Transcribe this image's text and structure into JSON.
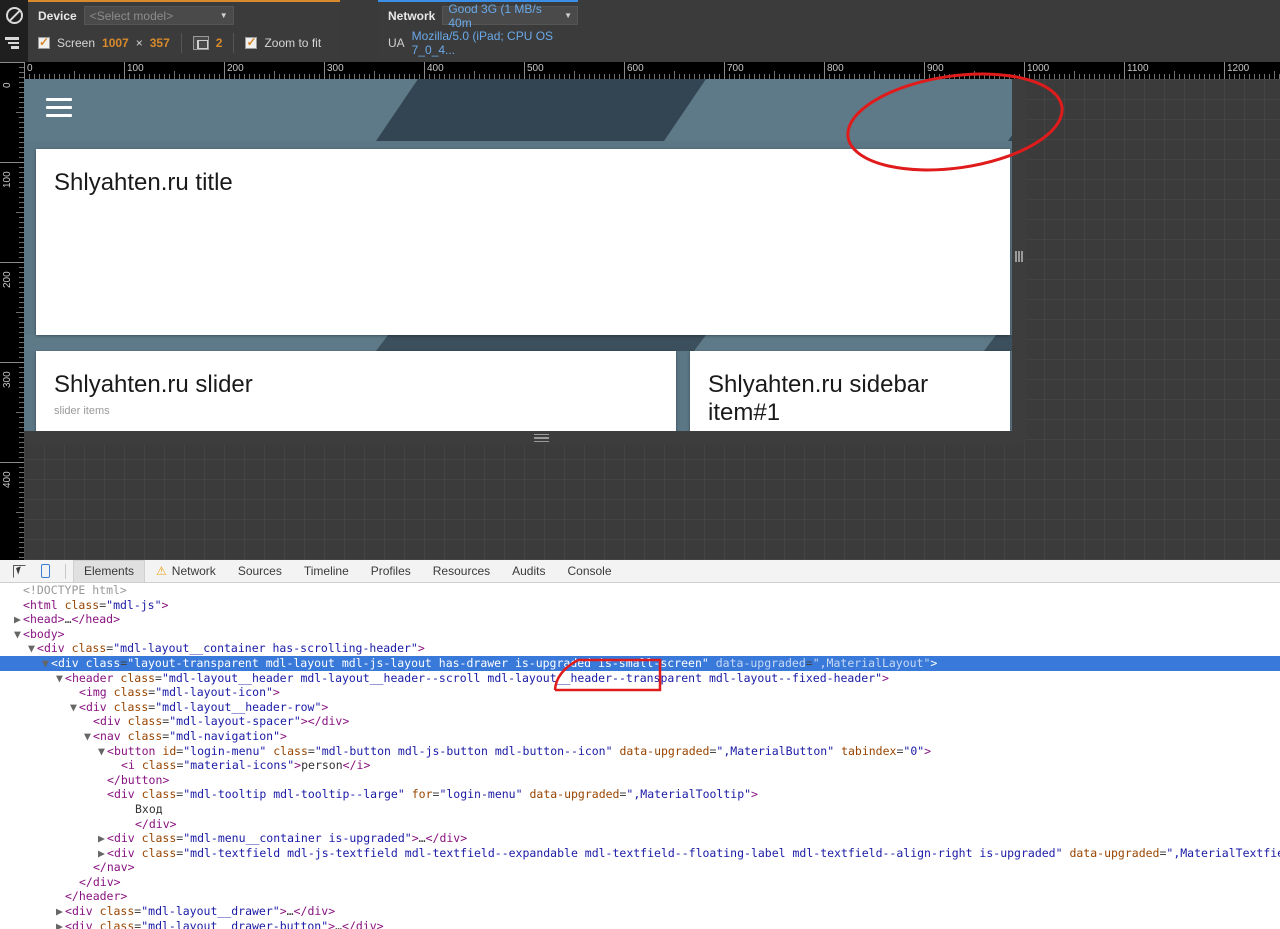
{
  "device_toolbar": {
    "icons": {
      "block": "block-icon",
      "throttle": "network-throttle-icon"
    },
    "device": {
      "label": "Device",
      "model_value": "<Select model>",
      "screen_label": "Screen",
      "width": "1007",
      "times": "×",
      "height": "357",
      "dpr_value": "2",
      "zoom_label": "Zoom to fit"
    },
    "network": {
      "label": "Network",
      "value": "Good 3G (1 MB/s 40m",
      "ua_label": "UA",
      "ua_value": "Mozilla/5.0 (iPad; CPU OS 7_0_4..."
    }
  },
  "rulers": {
    "horizontal": [
      "0",
      "100",
      "200",
      "300",
      "400",
      "500",
      "600",
      "700",
      "800",
      "900",
      "1000",
      "1100",
      "1200"
    ],
    "vertical": [
      "0",
      "100",
      "200",
      "300",
      "400"
    ]
  },
  "page": {
    "hamburger": "menu-icon",
    "title_card": "Shlyahten.ru title",
    "slider_card": "Shlyahten.ru slider",
    "slider_card_sub": "slider items",
    "sidebar_card": "Shlyahten.ru sidebar item#1"
  },
  "devtools": {
    "buttons": {
      "inspect": "inspect-element-icon",
      "device": "device-toolbar-icon"
    },
    "tabs": [
      {
        "label": "Elements",
        "active": true,
        "warn": false
      },
      {
        "label": "Network",
        "active": false,
        "warn": true
      },
      {
        "label": "Sources",
        "active": false,
        "warn": false
      },
      {
        "label": "Timeline",
        "active": false,
        "warn": false
      },
      {
        "label": "Profiles",
        "active": false,
        "warn": false
      },
      {
        "label": "Resources",
        "active": false,
        "warn": false
      },
      {
        "label": "Audits",
        "active": false,
        "warn": false
      },
      {
        "label": "Console",
        "active": false,
        "warn": false
      }
    ],
    "dom": [
      {
        "indent": 0,
        "arrow": "",
        "html": "<span class=\"cmt\">&lt;!DOCTYPE html&gt;</span>"
      },
      {
        "indent": 0,
        "arrow": "",
        "html": "<span class=\"punc\">&lt;</span><span class=\"tag\">html</span> <span class=\"attr\">class</span>=<span class=\"val\">\"mdl-js\"</span><span class=\"punc\">&gt;</span>"
      },
      {
        "indent": 0,
        "arrow": "▶",
        "html": "<span class=\"punc\">&lt;</span><span class=\"tag\">head</span><span class=\"punc\">&gt;</span><span class=\"txt\">…</span><span class=\"punc\">&lt;/</span><span class=\"tag\">head</span><span class=\"punc\">&gt;</span>"
      },
      {
        "indent": 0,
        "arrow": "▼",
        "html": "<span class=\"punc\">&lt;</span><span class=\"tag\">body</span><span class=\"punc\">&gt;</span>"
      },
      {
        "indent": 1,
        "arrow": "▼",
        "html": "<span class=\"punc\">&lt;</span><span class=\"tag\">div</span> <span class=\"attr\">class</span>=<span class=\"val\">\"mdl-layout__container has-scrolling-header\"</span><span class=\"punc\">&gt;</span>"
      },
      {
        "indent": 2,
        "arrow": "▼",
        "sel": true,
        "html": "<span class=\"punc\">&lt;</span><span class=\"tag\">div</span> <span class=\"attr\">class</span>=<span class=\"val\">\"layout-transparent mdl-layout mdl-js-layout has-drawer is-upgraded is-small-screen\"</span> <span class=\"attr-dim\">data-upgraded</span>=<span class=\"attr-dim\">\",MaterialLayout\"</span><span class=\"punc\">&gt;</span>"
      },
      {
        "indent": 3,
        "arrow": "▼",
        "html": "<span class=\"punc\">&lt;</span><span class=\"tag\">header</span> <span class=\"attr\">class</span>=<span class=\"val\">\"mdl-layout__header mdl-layout__header--scroll mdl-layout__header--transparent mdl-layout--fixed-header\"</span><span class=\"punc\">&gt;</span>"
      },
      {
        "indent": 4,
        "arrow": "",
        "html": "<span class=\"punc\">&lt;</span><span class=\"tag\">img</span> <span class=\"attr\">class</span>=<span class=\"val\">\"mdl-layout-icon\"</span><span class=\"punc\">&gt;</span>"
      },
      {
        "indent": 4,
        "arrow": "▼",
        "html": "<span class=\"punc\">&lt;</span><span class=\"tag\">div</span> <span class=\"attr\">class</span>=<span class=\"val\">\"mdl-layout__header-row\"</span><span class=\"punc\">&gt;</span>"
      },
      {
        "indent": 5,
        "arrow": "",
        "html": "<span class=\"punc\">&lt;</span><span class=\"tag\">div</span> <span class=\"attr\">class</span>=<span class=\"val\">\"mdl-layout-spacer\"</span><span class=\"punc\">&gt;&lt;/</span><span class=\"tag\">div</span><span class=\"punc\">&gt;</span>"
      },
      {
        "indent": 5,
        "arrow": "▼",
        "html": "<span class=\"punc\">&lt;</span><span class=\"tag\">nav</span> <span class=\"attr\">class</span>=<span class=\"val\">\"mdl-navigation\"</span><span class=\"punc\">&gt;</span>"
      },
      {
        "indent": 6,
        "arrow": "▼",
        "html": "<span class=\"punc\">&lt;</span><span class=\"tag\">button</span> <span class=\"attr\">id</span>=<span class=\"val\">\"login-menu\"</span> <span class=\"attr\">class</span>=<span class=\"val\">\"mdl-button mdl-js-button mdl-button--icon\"</span> <span class=\"attr\">data-upgraded</span>=<span class=\"val\">\",MaterialButton\"</span> <span class=\"attr\">tabindex</span>=<span class=\"val\">\"0\"</span><span class=\"punc\">&gt;</span>"
      },
      {
        "indent": 7,
        "arrow": "",
        "html": "<span class=\"punc\">&lt;</span><span class=\"tag\">i</span> <span class=\"attr\">class</span>=<span class=\"val\">\"material-icons\"</span><span class=\"punc\">&gt;</span><span class=\"txt\">person</span><span class=\"punc\">&lt;/</span><span class=\"tag\">i</span><span class=\"punc\">&gt;</span>"
      },
      {
        "indent": 6,
        "arrow": "",
        "html": "<span class=\"punc\">&lt;/</span><span class=\"tag\">button</span><span class=\"punc\">&gt;</span>"
      },
      {
        "indent": 6,
        "arrow": "",
        "html": "<span class=\"punc\">&lt;</span><span class=\"tag\">div</span> <span class=\"attr\">class</span>=<span class=\"val\">\"mdl-tooltip mdl-tooltip--large\"</span> <span class=\"attr\">for</span>=<span class=\"val\">\"login-menu\"</span> <span class=\"attr\">data-upgraded</span>=<span class=\"val\">\",MaterialTooltip\"</span><span class=\"punc\">&gt;</span>"
      },
      {
        "indent": 8,
        "arrow": "",
        "html": "<span class=\"txt\">Вход</span>"
      },
      {
        "indent": 8,
        "arrow": "",
        "html": "<span class=\"punc\">&lt;/</span><span class=\"tag\">div</span><span class=\"punc\">&gt;</span>"
      },
      {
        "indent": 6,
        "arrow": "▶",
        "html": "<span class=\"punc\">&lt;</span><span class=\"tag\">div</span> <span class=\"attr\">class</span>=<span class=\"val\">\"mdl-menu__container is-upgraded\"</span><span class=\"punc\">&gt;</span><span class=\"txt\">…</span><span class=\"punc\">&lt;/</span><span class=\"tag\">div</span><span class=\"punc\">&gt;</span>"
      },
      {
        "indent": 6,
        "arrow": "▶",
        "html": "<span class=\"punc\">&lt;</span><span class=\"tag\">div</span> <span class=\"attr\">class</span>=<span class=\"val\">\"mdl-textfield mdl-js-textfield mdl-textfield--expandable mdl-textfield--floating-label mdl-textfield--align-right is-upgraded\"</span> <span class=\"attr\">data-upgraded</span>=<span class=\"val\">\",MaterialTextfield\"</span><span class=\"punc\">&gt;</span><span class=\"txt\">…</span><span class=\"punc\">&lt;/</span><span class=\"tag\">div</span><span class=\"punc\">&gt;</span>"
      },
      {
        "indent": 5,
        "arrow": "",
        "html": "<span class=\"punc\">&lt;/</span><span class=\"tag\">nav</span><span class=\"punc\">&gt;</span>"
      },
      {
        "indent": 4,
        "arrow": "",
        "html": "<span class=\"punc\">&lt;/</span><span class=\"tag\">div</span><span class=\"punc\">&gt;</span>"
      },
      {
        "indent": 3,
        "arrow": "",
        "html": "<span class=\"punc\">&lt;/</span><span class=\"tag\">header</span><span class=\"punc\">&gt;</span>"
      },
      {
        "indent": 3,
        "arrow": "▶",
        "html": "<span class=\"punc\">&lt;</span><span class=\"tag\">div</span> <span class=\"attr\">class</span>=<span class=\"val\">\"mdl-layout__drawer\"</span><span class=\"punc\">&gt;</span><span class=\"txt\">…</span><span class=\"punc\">&lt;/</span><span class=\"tag\">div</span><span class=\"punc\">&gt;</span>"
      },
      {
        "indent": 3,
        "arrow": "▶",
        "html": "<span class=\"punc\">&lt;</span><span class=\"tag\">div</span> <span class=\"attr\">class</span>=<span class=\"val\">\"mdl-layout__drawer-button\"</span><span class=\"punc\">&gt;</span><span class=\"txt\">…</span><span class=\"punc\">&lt;/</span><span class=\"tag\">div</span><span class=\"punc\">&gt;</span>"
      }
    ]
  },
  "annotations": {
    "color": "#e01b1b",
    "marks": [
      "circle-around-header-right",
      "underline-is-small-screen"
    ]
  },
  "colors": {
    "toolbar_bg": "#3b3b3b",
    "device_accent": "#d98a2b",
    "network_accent": "#3a8ee6",
    "header_teal": "#5e7a88",
    "header_dark": "#334552",
    "selection_blue": "#3879d9"
  }
}
